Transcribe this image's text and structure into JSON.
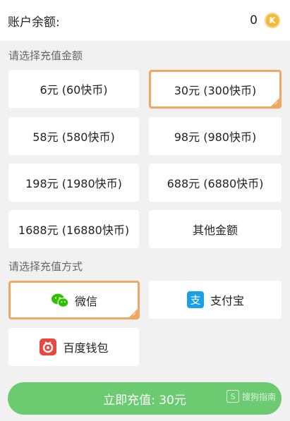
{
  "balance": {
    "label": "账户余额:",
    "value": "0",
    "coin_letter": "K",
    "coin_color": "#f5b93a"
  },
  "amount_section": {
    "title": "请选择充值金额",
    "options": [
      {
        "label": "6元 (60快币)",
        "selected": false
      },
      {
        "label": "30元 (300快币)",
        "selected": true
      },
      {
        "label": "58元 (580快币)",
        "selected": false
      },
      {
        "label": "98元 (980快币)",
        "selected": false
      },
      {
        "label": "198元 (1980快币)",
        "selected": false
      },
      {
        "label": "688元 (6880快币)",
        "selected": false
      },
      {
        "label": "1688元 (16880快币)",
        "selected": false
      },
      {
        "label": "其他金额",
        "selected": false
      }
    ]
  },
  "method_section": {
    "title": "请选择充值方式",
    "methods": [
      {
        "label": "微信",
        "icon": "wechat-icon",
        "selected": true
      },
      {
        "label": "支付宝",
        "icon": "alipay-icon",
        "selected": false
      },
      {
        "label": "百度钱包",
        "icon": "baidu-wallet-icon",
        "selected": false
      }
    ]
  },
  "charge_button": {
    "label": "立即充值: 30元",
    "color": "#6ccb70"
  },
  "watermark": {
    "logo": "S",
    "text": "搜狗指南"
  },
  "accent_color": "#efa862"
}
